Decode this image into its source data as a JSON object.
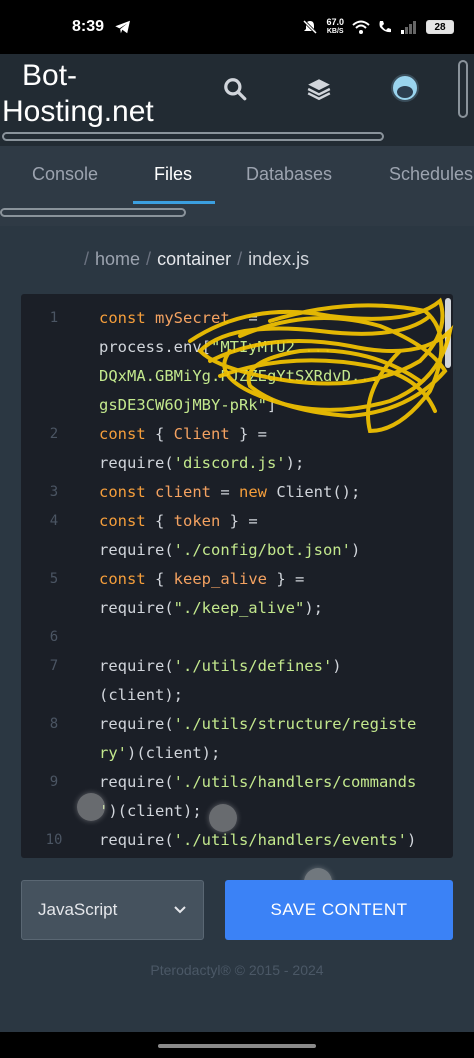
{
  "status": {
    "time": "8:39",
    "net_speed_value": "67.0",
    "net_speed_unit": "KB/S",
    "battery": "28"
  },
  "header": {
    "brand_line1": "Bot-",
    "brand_line2": "Hosting.net"
  },
  "tabs": [
    {
      "label": "Console"
    },
    {
      "label": "Files"
    },
    {
      "label": "Databases"
    },
    {
      "label": "Schedules"
    }
  ],
  "breadcrumb": {
    "root": "home",
    "folder": "container",
    "file": "index.js",
    "sep": "/"
  },
  "editor": {
    "lines": [
      {
        "n": "1",
        "parts": [
          [
            "kw",
            "const "
          ],
          [
            "var",
            "mySecret"
          ],
          [
            "",
            "  =\nprocess.env["
          ],
          [
            "str",
            "\"MTIyMTU2 ...\nDQxMA.GBMiYg.PJZZEgYtSXRdvD...\ngsDE3CW6OjMBY-pRk\""
          ],
          [
            "",
            "]"
          ]
        ]
      },
      {
        "n": "2",
        "parts": [
          [
            "kw",
            "const "
          ],
          [
            "",
            "{ "
          ],
          [
            "var",
            "Client"
          ],
          [
            "",
            " } =\nrequire("
          ],
          [
            "str",
            "'discord.js'"
          ],
          [
            "",
            ");"
          ]
        ]
      },
      {
        "n": "3",
        "parts": [
          [
            "kw",
            "const "
          ],
          [
            "var",
            "client"
          ],
          [
            "",
            " = "
          ],
          [
            "kw",
            "new "
          ],
          [
            "",
            "Client();"
          ]
        ]
      },
      {
        "n": "4",
        "parts": [
          [
            "kw",
            "const "
          ],
          [
            "",
            "{ "
          ],
          [
            "var",
            "token"
          ],
          [
            "",
            " } =\nrequire("
          ],
          [
            "str",
            "'./config/bot.json'"
          ],
          [
            "",
            ")"
          ]
        ]
      },
      {
        "n": "5",
        "parts": [
          [
            "kw",
            "const "
          ],
          [
            "",
            "{ "
          ],
          [
            "var",
            "keep_alive"
          ],
          [
            "",
            " } =\nrequire("
          ],
          [
            "str",
            "\"./keep_alive\""
          ],
          [
            "",
            ");"
          ]
        ]
      },
      {
        "n": "6",
        "parts": [
          [
            "",
            ""
          ]
        ]
      },
      {
        "n": "7",
        "parts": [
          [
            "",
            "require("
          ],
          [
            "str",
            "'./utils/defines'"
          ],
          [
            "",
            ")\n(client);"
          ]
        ]
      },
      {
        "n": "8",
        "parts": [
          [
            "",
            "require("
          ],
          [
            "str",
            "'./utils/structure/registe\nry'"
          ],
          [
            "",
            ")(client);"
          ]
        ]
      },
      {
        "n": "9",
        "parts": [
          [
            "",
            "require("
          ],
          [
            "str",
            "'./utils/handlers/commands\n'"
          ],
          [
            "",
            ")(client);"
          ]
        ]
      },
      {
        "n": "10",
        "parts": [
          [
            "",
            "require("
          ],
          [
            "str",
            "'./utils/handlers/events'"
          ],
          [
            "",
            ")\n(client);"
          ]
        ]
      }
    ]
  },
  "language_select": {
    "value": "JavaScript"
  },
  "save_button": {
    "label": "SAVE CONTENT"
  },
  "footer": {
    "text": "Pterodactyl® © 2015 - 2024"
  },
  "colors": {
    "accent": "#3b82f6",
    "tab_underline": "#3b9fe0",
    "scribble": "#f5c400"
  },
  "icons": [
    "telegram-icon",
    "search-icon",
    "layers-icon",
    "avatar",
    "chevron-down-icon"
  ]
}
